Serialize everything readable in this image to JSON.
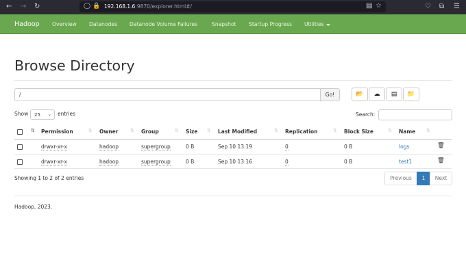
{
  "browser": {
    "url_host": "192.168.1.6",
    "url_rest": ":9870/explorer.html#/"
  },
  "navbar": {
    "brand": "Hadoop",
    "links": [
      "Overview",
      "Datanodes",
      "Datanode Volume Failures",
      "Snapshot",
      "Startup Progress",
      "Utilities"
    ]
  },
  "page_title": "Browse Directory",
  "path_input": "/",
  "go_label": "Go!",
  "show_label": "Show",
  "page_size": "25",
  "entries_label": "entries",
  "search_label": "Search:",
  "columns": [
    "Permission",
    "Owner",
    "Group",
    "Size",
    "Last Modified",
    "Replication",
    "Block Size",
    "Name"
  ],
  "rows": [
    {
      "permission": "drwxr-xr-x",
      "owner": "hadoop",
      "group": "supergroup",
      "size": "0 B",
      "modified": "Sep 10 13:19",
      "replication": "0",
      "block_size": "0 B",
      "name": "logs"
    },
    {
      "permission": "drwxr-xr-x",
      "owner": "hadoop",
      "group": "supergroup",
      "size": "0 B",
      "modified": "Sep 10 13:16",
      "replication": "0",
      "block_size": "0 B",
      "name": "test1"
    }
  ],
  "table_info": "Showing 1 to 2 of 2 entries",
  "pagination": {
    "previous": "Previous",
    "current": "1",
    "next": "Next"
  },
  "footer": "Hadoop, 2023.",
  "colors": {
    "navbar": "#6aa84f",
    "link": "#337ab7"
  }
}
